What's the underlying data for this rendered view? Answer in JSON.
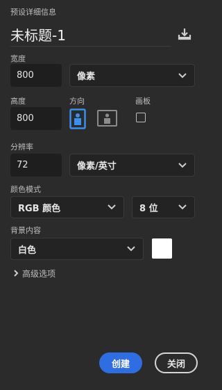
{
  "header": {
    "title": "预设详细信息",
    "document_name": "未标题-1",
    "save_icon": "save-preset-icon"
  },
  "width": {
    "label": "宽度",
    "value": "800",
    "unit": "像素"
  },
  "height": {
    "label": "高度",
    "value": "800"
  },
  "orientation": {
    "label": "方向",
    "selected": "portrait"
  },
  "artboard": {
    "label": "画板",
    "checked": false
  },
  "resolution": {
    "label": "分辨率",
    "value": "72",
    "unit": "像素/英寸"
  },
  "color_mode": {
    "label": "颜色模式",
    "mode": "RGB 颜色",
    "depth": "8 位"
  },
  "background": {
    "label": "背景内容",
    "value": "白色",
    "swatch_color": "#ffffff"
  },
  "advanced": {
    "label": "高级选项"
  },
  "actions": {
    "create_label": "创建",
    "close_label": "关闭"
  },
  "colors": {
    "accent": "#2f6ee2",
    "orientation_active": "#3b8ff0"
  }
}
